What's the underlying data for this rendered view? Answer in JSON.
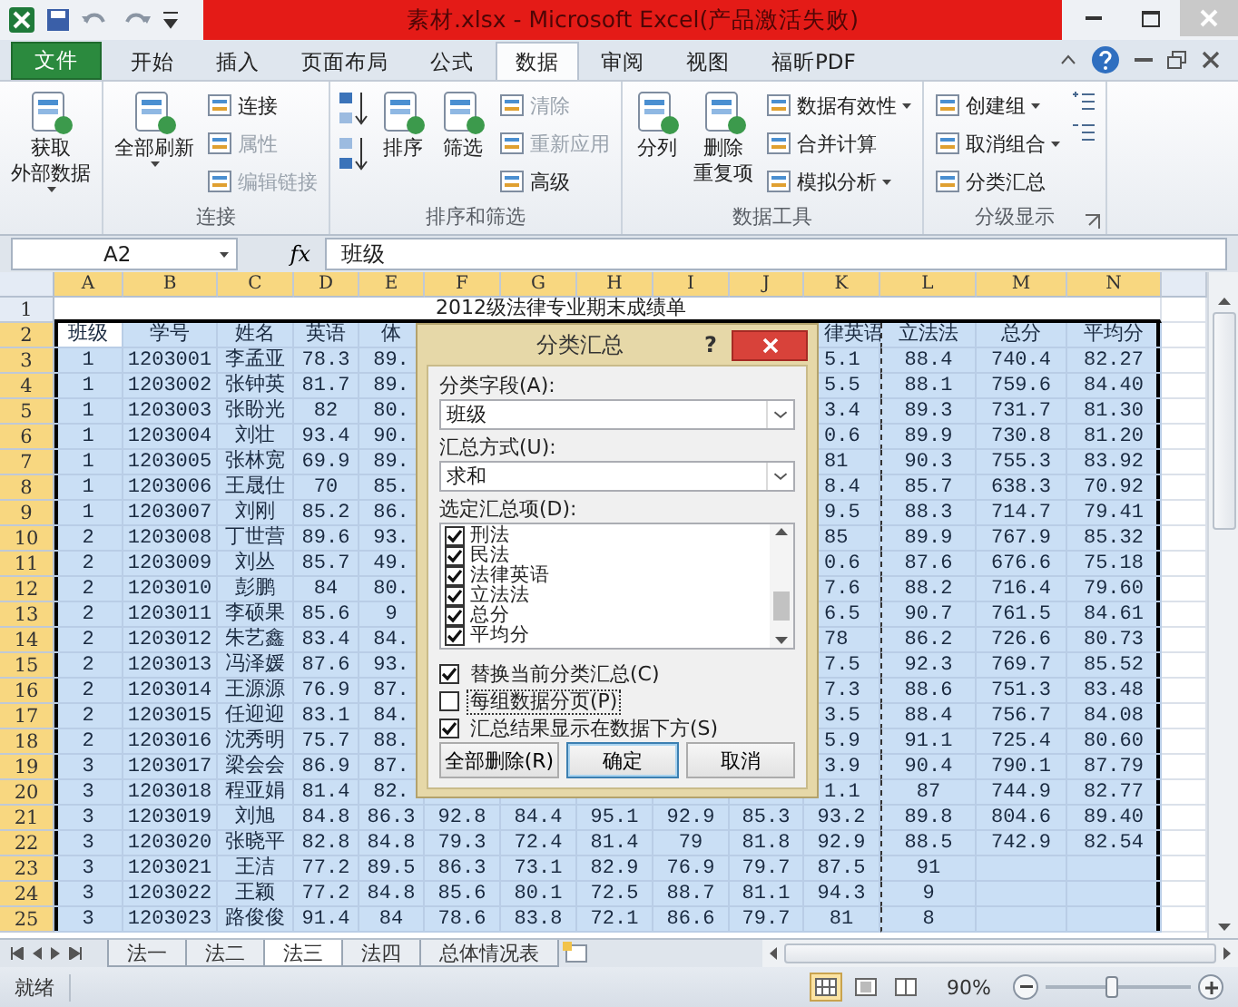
{
  "window": {
    "title": "素材.xlsx - Microsoft Excel(产品激活失败)"
  },
  "ribbon_tabs": [
    {
      "label": "文件",
      "kind": "file",
      "selected": false
    },
    {
      "label": "开始",
      "kind": "tab",
      "selected": false
    },
    {
      "label": "插入",
      "kind": "tab",
      "selected": false
    },
    {
      "label": "页面布局",
      "kind": "tab",
      "selected": false
    },
    {
      "label": "公式",
      "kind": "tab",
      "selected": false
    },
    {
      "label": "数据",
      "kind": "tab",
      "selected": true
    },
    {
      "label": "审阅",
      "kind": "tab",
      "selected": false
    },
    {
      "label": "视图",
      "kind": "tab",
      "selected": false
    },
    {
      "label": "福昕PDF",
      "kind": "tab",
      "selected": false
    }
  ],
  "ribbon_groups": [
    {
      "launcher": false,
      "columns": [
        [
          {
            "kind": "large",
            "lines": [
              "获取",
              "外部数据"
            ],
            "menu": true,
            "disabled": false
          }
        ]
      ]
    },
    {
      "label": "连接",
      "launcher": false,
      "columns": [
        [
          {
            "kind": "large",
            "lines": [
              "全部刷新"
            ],
            "menu": true,
            "disabled": false
          }
        ],
        [
          {
            "kind": "small",
            "label": "连接",
            "menu": false,
            "disabled": false
          },
          {
            "kind": "small",
            "label": "属性",
            "menu": false,
            "disabled": true
          },
          {
            "kind": "small",
            "label": "编辑链接",
            "menu": false,
            "disabled": true
          }
        ]
      ]
    },
    {
      "label": "排序和筛选",
      "launcher": false,
      "columns": [
        [
          {
            "kind": "sort"
          }
        ],
        [
          {
            "kind": "large",
            "lines": [
              "排序"
            ],
            "menu": false,
            "disabled": false
          }
        ],
        [
          {
            "kind": "large",
            "lines": [
              "筛选"
            ],
            "menu": false,
            "disabled": false
          }
        ],
        [
          {
            "kind": "small",
            "label": "清除",
            "menu": false,
            "disabled": true
          },
          {
            "kind": "small",
            "label": "重新应用",
            "menu": false,
            "disabled": true
          },
          {
            "kind": "small",
            "label": "高级",
            "menu": false,
            "disabled": false
          }
        ]
      ]
    },
    {
      "label": "数据工具",
      "launcher": false,
      "columns": [
        [
          {
            "kind": "large",
            "lines": [
              "分列"
            ],
            "menu": false,
            "disabled": false
          }
        ],
        [
          {
            "kind": "large",
            "lines": [
              "删除",
              "重复项"
            ],
            "menu": false,
            "disabled": false
          }
        ],
        [
          {
            "kind": "small",
            "label": "数据有效性",
            "menu": true,
            "disabled": false
          },
          {
            "kind": "small",
            "label": "合并计算",
            "menu": false,
            "disabled": false
          },
          {
            "kind": "small",
            "label": "模拟分析",
            "menu": true,
            "disabled": false
          }
        ]
      ]
    },
    {
      "label": "分级显示",
      "launcher": true,
      "columns": [
        [
          {
            "kind": "small",
            "label": "创建组",
            "menu": true,
            "disabled": false
          },
          {
            "kind": "small",
            "label": "取消组合",
            "menu": true,
            "disabled": false
          },
          {
            "kind": "small",
            "label": "分类汇总",
            "menu": false,
            "disabled": false
          }
        ],
        [
          {
            "kind": "outline"
          }
        ]
      ]
    }
  ],
  "formula_bar": {
    "name_box": "A2",
    "function_button": "fx",
    "formula": "班级"
  },
  "sheet": {
    "columns": [
      {
        "label": "A",
        "selected": true
      },
      {
        "label": "B",
        "selected": true
      },
      {
        "label": "C",
        "selected": true
      },
      {
        "label": "D",
        "selected": true
      },
      {
        "label": "E",
        "selected": true
      },
      {
        "label": "F",
        "selected": true
      },
      {
        "label": "G",
        "selected": true
      },
      {
        "label": "H",
        "selected": true
      },
      {
        "label": "I",
        "selected": true
      },
      {
        "label": "J",
        "selected": true
      },
      {
        "label": "K",
        "selected": true
      },
      {
        "label": "L",
        "selected": true
      },
      {
        "label": "M",
        "selected": true
      },
      {
        "label": "N",
        "selected": true
      }
    ],
    "rows": [
      {
        "number": "1",
        "kind": "title",
        "selected": false,
        "title": "2012级法律专业期末成绩单"
      },
      {
        "number": "2",
        "kind": "data",
        "selected": true,
        "cells": [
          "班级",
          "学号",
          "姓名",
          "英语",
          "体",
          null,
          null,
          null,
          null,
          null,
          "律英语",
          "立法法",
          "总分",
          "平均分"
        ]
      },
      {
        "number": "3",
        "kind": "data",
        "selected": true,
        "cells": [
          "1",
          "1203001",
          "李孟亚",
          "78.3",
          "89.",
          null,
          null,
          null,
          null,
          null,
          "5.1",
          "88.4",
          "740.4",
          "82.27"
        ]
      },
      {
        "number": "4",
        "kind": "data",
        "selected": true,
        "cells": [
          "1",
          "1203002",
          "张钟英",
          "81.7",
          "89.",
          null,
          null,
          null,
          null,
          null,
          "5.5",
          "88.1",
          "759.6",
          "84.40"
        ]
      },
      {
        "number": "5",
        "kind": "data",
        "selected": true,
        "cells": [
          "1",
          "1203003",
          "张盼光",
          "82",
          "80.",
          null,
          null,
          null,
          null,
          null,
          "3.4",
          "89.3",
          "731.7",
          "81.30"
        ]
      },
      {
        "number": "6",
        "kind": "data",
        "selected": true,
        "cells": [
          "1",
          "1203004",
          "刘壮",
          "93.4",
          "90.",
          null,
          null,
          null,
          null,
          null,
          "0.6",
          "89.9",
          "730.8",
          "81.20"
        ]
      },
      {
        "number": "7",
        "kind": "data",
        "selected": true,
        "cells": [
          "1",
          "1203005",
          "张林宽",
          "69.9",
          "89.",
          null,
          null,
          null,
          null,
          null,
          "81",
          "90.3",
          "755.3",
          "83.92"
        ]
      },
      {
        "number": "8",
        "kind": "data",
        "selected": true,
        "cells": [
          "1",
          "1203006",
          "王晟仕",
          "70",
          "85.",
          null,
          null,
          null,
          null,
          null,
          "8.4",
          "85.7",
          "638.3",
          "70.92"
        ]
      },
      {
        "number": "9",
        "kind": "data",
        "selected": true,
        "cells": [
          "1",
          "1203007",
          "刘刚",
          "85.2",
          "86.",
          null,
          null,
          null,
          null,
          null,
          "9.5",
          "88.3",
          "714.7",
          "79.41"
        ]
      },
      {
        "number": "10",
        "kind": "data",
        "selected": true,
        "cells": [
          "2",
          "1203008",
          "丁世营",
          "89.6",
          "93.",
          null,
          null,
          null,
          null,
          null,
          "85",
          "89.9",
          "767.9",
          "85.32"
        ]
      },
      {
        "number": "11",
        "kind": "data",
        "selected": true,
        "cells": [
          "2",
          "1203009",
          "刘丛",
          "85.7",
          "49.",
          null,
          null,
          null,
          null,
          null,
          "0.6",
          "87.6",
          "676.6",
          "75.18"
        ]
      },
      {
        "number": "12",
        "kind": "data",
        "selected": true,
        "cells": [
          "2",
          "1203010",
          "彭鹏",
          "84",
          "80.",
          null,
          null,
          null,
          null,
          null,
          "7.6",
          "88.2",
          "716.4",
          "79.60"
        ]
      },
      {
        "number": "13",
        "kind": "data",
        "selected": true,
        "cells": [
          "2",
          "1203011",
          "李硕果",
          "85.6",
          "9",
          null,
          null,
          null,
          null,
          null,
          "6.5",
          "90.7",
          "761.5",
          "84.61"
        ]
      },
      {
        "number": "14",
        "kind": "data",
        "selected": true,
        "cells": [
          "2",
          "1203012",
          "朱艺鑫",
          "83.4",
          "84.",
          null,
          null,
          null,
          null,
          null,
          "78",
          "86.2",
          "726.6",
          "80.73"
        ]
      },
      {
        "number": "15",
        "kind": "data",
        "selected": true,
        "cells": [
          "2",
          "1203013",
          "冯泽媛",
          "87.6",
          "93.",
          null,
          null,
          null,
          null,
          null,
          "7.5",
          "92.3",
          "769.7",
          "85.52"
        ]
      },
      {
        "number": "16",
        "kind": "data",
        "selected": true,
        "cells": [
          "2",
          "1203014",
          "王源源",
          "76.9",
          "87.",
          null,
          null,
          null,
          null,
          null,
          "7.3",
          "88.6",
          "751.3",
          "83.48"
        ]
      },
      {
        "number": "17",
        "kind": "data",
        "selected": true,
        "cells": [
          "2",
          "1203015",
          "任迎迎",
          "83.1",
          "84.",
          null,
          null,
          null,
          null,
          null,
          "3.5",
          "88.4",
          "756.7",
          "84.08"
        ]
      },
      {
        "number": "18",
        "kind": "data",
        "selected": true,
        "cells": [
          "2",
          "1203016",
          "沈秀明",
          "75.7",
          "88.",
          null,
          null,
          null,
          null,
          null,
          "5.9",
          "91.1",
          "725.4",
          "80.60"
        ]
      },
      {
        "number": "19",
        "kind": "data",
        "selected": true,
        "cells": [
          "3",
          "1203017",
          "梁会会",
          "86.9",
          "87.",
          null,
          null,
          null,
          null,
          null,
          "3.9",
          "90.4",
          "790.1",
          "87.79"
        ]
      },
      {
        "number": "20",
        "kind": "data",
        "selected": true,
        "cells": [
          "3",
          "1203018",
          "程亚娟",
          "81.4",
          "82.",
          null,
          null,
          null,
          null,
          null,
          "1.1",
          "87",
          "744.9",
          "82.77"
        ]
      },
      {
        "number": "21",
        "kind": "data",
        "selected": true,
        "cells": [
          "3",
          "1203019",
          "刘旭",
          "84.8",
          "86.3",
          "92.8",
          "84.4",
          "95.1",
          "92.9",
          "85.3",
          "93.2",
          "89.8",
          "804.6",
          "89.40"
        ]
      },
      {
        "number": "22",
        "kind": "data",
        "selected": true,
        "cells": [
          "3",
          "1203020",
          "张晓平",
          "82.8",
          "84.8",
          "79.3",
          "72.4",
          "81.4",
          "79",
          "81.8",
          "92.9",
          "88.5",
          "742.9",
          "82.54"
        ]
      },
      {
        "number": "23",
        "kind": "data",
        "selected": true,
        "cells": [
          "3",
          "1203021",
          "王洁",
          "77.2",
          "89.5",
          "86.3",
          "73.1",
          "82.9",
          "76.9",
          "79.7",
          "87.5",
          "91",
          null,
          null
        ]
      },
      {
        "number": "24",
        "kind": "data",
        "selected": true,
        "cells": [
          "3",
          "1203022",
          "王颖",
          "77.2",
          "84.8",
          "85.6",
          "80.1",
          "72.5",
          "88.7",
          "81.1",
          "94.3",
          "9",
          null,
          null
        ]
      },
      {
        "number": "25",
        "kind": "data",
        "selected": true,
        "cells": [
          "3",
          "1203023",
          "路俊俊",
          "91.4",
          "84",
          "78.6",
          "83.8",
          "72.1",
          "86.6",
          "79.7",
          "81",
          "8",
          null,
          null
        ]
      }
    ]
  },
  "dialog": {
    "title": "分类汇总",
    "help": "?",
    "field_label": "分类字段(A):",
    "field_value": "班级",
    "function_label": "汇总方式(U):",
    "function_value": "求和",
    "items_label": "选定汇总项(D):",
    "items": [
      {
        "label": "刑法",
        "checked": true
      },
      {
        "label": "民法",
        "checked": true
      },
      {
        "label": "法律英语",
        "checked": true
      },
      {
        "label": "立法法",
        "checked": true
      },
      {
        "label": "总分",
        "checked": true
      },
      {
        "label": "平均分",
        "checked": true
      }
    ],
    "options": [
      {
        "label": "替换当前分类汇总(C)",
        "checked": true,
        "focused": false
      },
      {
        "label": "每组数据分页(P)",
        "checked": false,
        "focused": true
      },
      {
        "label": "汇总结果显示在数据下方(S)",
        "checked": true,
        "focused": false
      }
    ],
    "buttons": [
      {
        "label": "全部删除(R)",
        "default": false
      },
      {
        "label": "确定",
        "default": true
      },
      {
        "label": "取消",
        "default": false
      }
    ]
  },
  "sheet_tabs": [
    {
      "label": "法一",
      "selected": false
    },
    {
      "label": "法二",
      "selected": false
    },
    {
      "label": "法三",
      "selected": true
    },
    {
      "label": "法四",
      "selected": false
    },
    {
      "label": "总体情况表",
      "selected": false
    }
  ],
  "status_bar": {
    "status": "就绪",
    "zoom": {
      "reading": "90%",
      "level": 0.45
    }
  }
}
